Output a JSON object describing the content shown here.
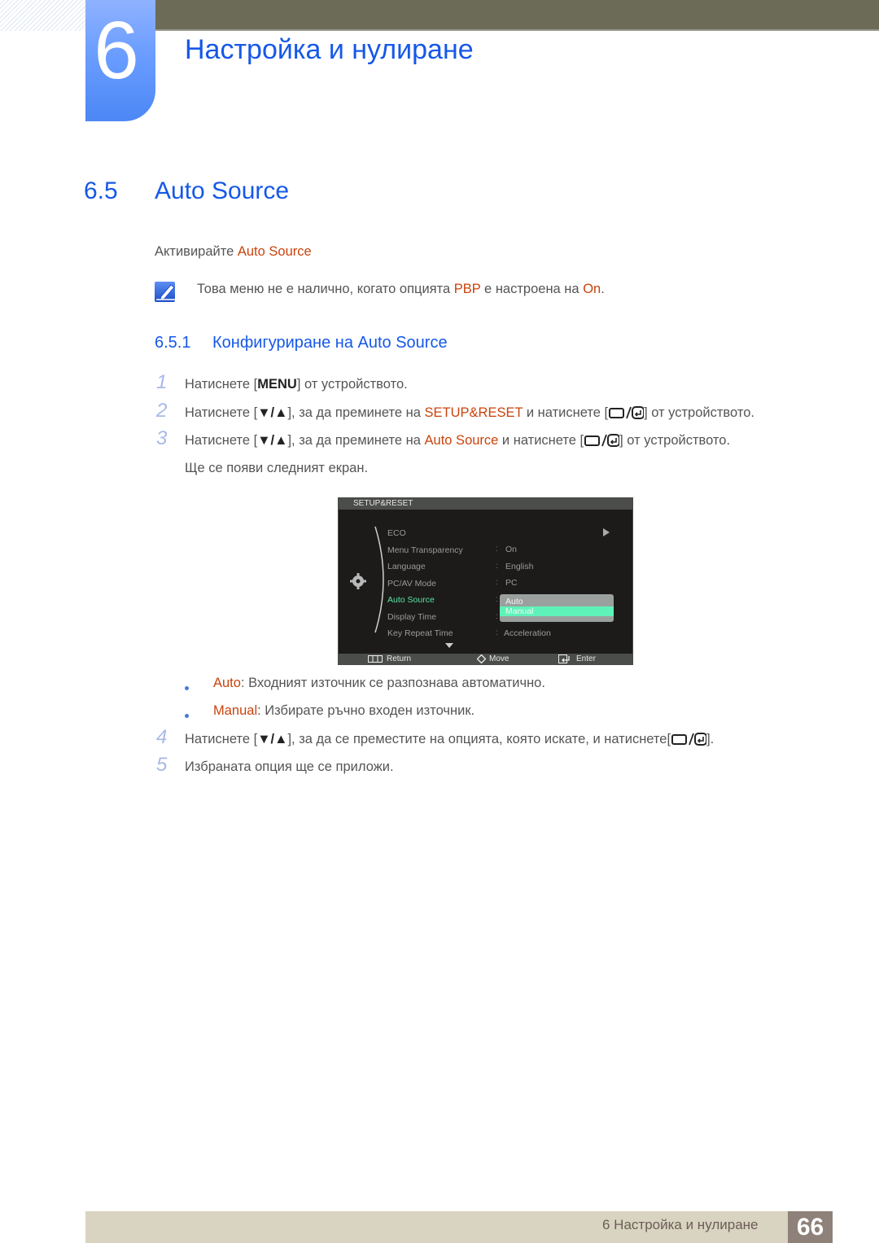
{
  "chapter": {
    "number": "6",
    "title": "Настройка и нулиране"
  },
  "section": {
    "number": "6.5",
    "title": "Auto Source"
  },
  "intro": {
    "prefix": "Активирайте ",
    "highlight": "Auto Source"
  },
  "note": {
    "icon": "note-pencil-icon",
    "t1": "Това меню не е налично, когато опцията ",
    "h1": "PBP",
    "t2": " е настроена на ",
    "h2": "On",
    "t3": "."
  },
  "subsection": {
    "number": "6.5.1",
    "title": "Конфигуриране на Auto Source"
  },
  "steps": [
    {
      "num": "1",
      "t1": "Натиснете [",
      "key": "MENU",
      "t2": "] от устройството."
    },
    {
      "num": "2",
      "t1": "Натиснете [",
      "key": "▼/▲",
      "t2": "], за да преминете на ",
      "h": "SETUP&RESET",
      "t3": " и натиснете [",
      "t4": "] от устройството."
    },
    {
      "num": "3",
      "t1": "Натиснете [",
      "key": "▼/▲",
      "t2": "], за да преминете на ",
      "h": "Auto Source",
      "t3": " и натиснете [",
      "t4": "] от устройството."
    },
    {
      "num": "",
      "t1": "Ще се появи следният екран."
    },
    {
      "num": "4",
      "t1": "Натиснете [",
      "key": "▼/▲",
      "t2": "], за да се преместите на опцията, която искате, и натиснете[",
      "t3": "]."
    },
    {
      "num": "5",
      "t1": "Избраната опция ще се приложи."
    }
  ],
  "osd": {
    "header": "SETUP&RESET",
    "items": [
      {
        "label": "ECO",
        "value": ""
      },
      {
        "label": "Menu Transparency",
        "value": "On"
      },
      {
        "label": "Language",
        "value": "English"
      },
      {
        "label": "PC/AV Mode",
        "value": "PC"
      },
      {
        "label": "Auto Source",
        "value": ""
      },
      {
        "label": "Display Time",
        "value": ""
      },
      {
        "label": "Key Repeat Time",
        "value": "Acceleration"
      }
    ],
    "dropdown": [
      "Auto",
      "Manual"
    ],
    "dropdown_selected": "Manual",
    "footer": {
      "return": "Return",
      "move": "Move",
      "enter": "Enter"
    },
    "colors": {
      "active": "#59e3a3",
      "selected": "#5ff2b8"
    }
  },
  "bullets": [
    {
      "h": "Auto",
      "t": ": Входният източник се разпознава автоматично."
    },
    {
      "h": "Manual",
      "t": ": Избирате ръчно входен източник."
    }
  ],
  "footer": {
    "text": "6 Настройка и нулиране",
    "page": "66"
  },
  "colors": {
    "heading": "#1658e8",
    "highlight": "#c9430c"
  }
}
